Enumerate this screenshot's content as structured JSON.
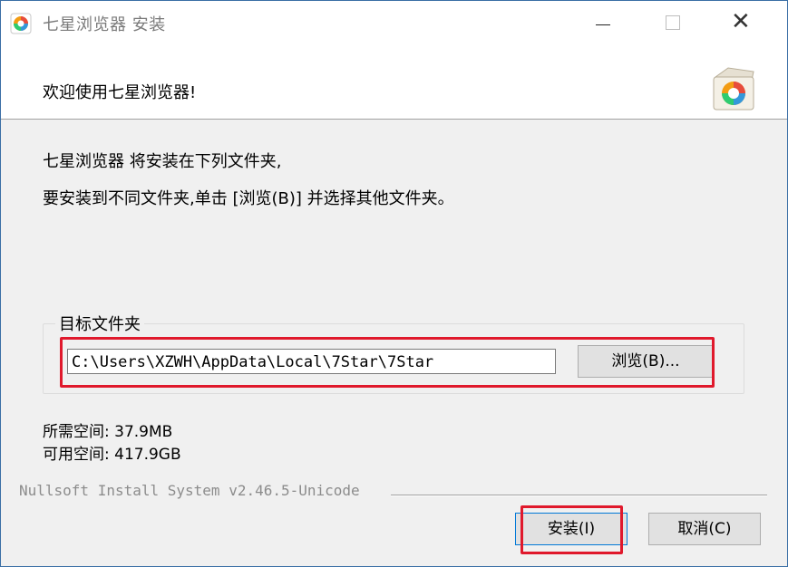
{
  "window": {
    "title": "七星浏览器 安装",
    "controls": {
      "minimize_icon": "minimize-icon",
      "maximize_icon": "maximize-icon",
      "close_icon": "close-icon",
      "close_glyph": "✕"
    }
  },
  "header": {
    "welcome": "欢迎使用七星浏览器!",
    "logo_icon": "installer-box-logo-icon"
  },
  "body": {
    "line1": "七星浏览器 将安装在下列文件夹,",
    "line2": "要安装到不同文件夹,单击 [浏览(B)] 并选择其他文件夹。"
  },
  "destination": {
    "group_label": "目标文件夹",
    "path_value": "C:\\Users\\XZWH\\AppData\\Local\\7Star\\7Star",
    "browse_label": "浏览(B)..."
  },
  "space": {
    "required": "所需空间: 37.9MB",
    "available": "可用空间: 417.9GB"
  },
  "footer": {
    "branding": "Nullsoft Install System v2.46.5-Unicode",
    "install_label": "安装(I)",
    "cancel_label": "取消(C)"
  },
  "colors": {
    "highlight_red": "#e0192c",
    "window_border": "#3a6ea5",
    "default_button_border": "#0078d7"
  }
}
